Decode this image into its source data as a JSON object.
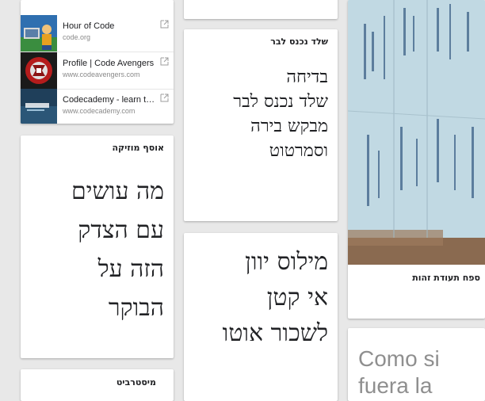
{
  "links": [
    {
      "title": "Hour of Code",
      "url": "code.org",
      "thumb": "hour-of-code-thumbnail"
    },
    {
      "title": "Profile | Code Avengers",
      "url": "www.codeavengers.com",
      "thumb": "code-avengers-thumbnail"
    },
    {
      "title": "Codecademy - learn to ...",
      "url": "www.codecademy.com",
      "thumb": "codecademy-thumbnail"
    }
  ],
  "note_kid": {
    "title": "שלד נכנס לבר",
    "lines": [
      "בדיחה",
      "שלד נכנס לבר",
      "מבקש בירה",
      "וסמרטוט"
    ]
  },
  "note_music": {
    "title": "אוסף מוזיקה",
    "lines": [
      "מה עושים",
      "עם הצדק",
      "הזה על",
      "הבוקר"
    ]
  },
  "note_milos": {
    "lines": [
      "מילוס יוון",
      "אי קטן",
      "לשכור אוטו"
    ]
  },
  "note_misterbit": {
    "title": "מיסטרביט"
  },
  "photo_card": {
    "caption": "ספח תעודת זהות"
  },
  "note_como": {
    "lines": [
      "Como si",
      "fuera la"
    ]
  },
  "colors": {
    "background": "#e8e8e8",
    "card": "#ffffff",
    "photo_blue": "#b9d3de",
    "photo_brown": "#8a6a50"
  }
}
